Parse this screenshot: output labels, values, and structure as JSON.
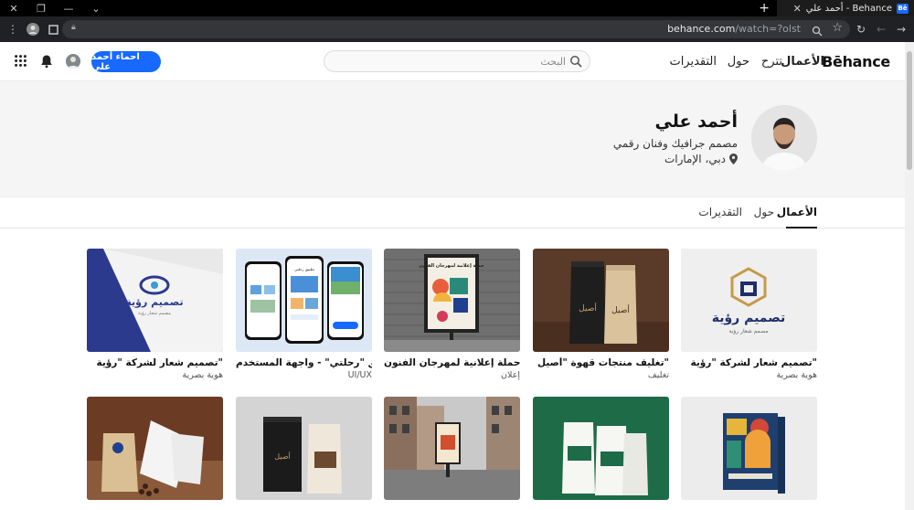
{
  "browser": {
    "tab_title": "أحمد علي - Behance",
    "tab_favicon": "Bē",
    "url_host": "behance.com",
    "url_path": "/watch=?olst"
  },
  "header": {
    "logo": "Bēhance",
    "nav": [
      "الأعمال",
      "تترح",
      "حول",
      "التقديرات"
    ],
    "search_placeholder": "البحث",
    "cta_label": "احماء أحمد علي",
    "accent": "#1769ff"
  },
  "profile": {
    "name": "أحمد علي",
    "title": "مصمم جرافيك وفنان رقمي",
    "location": "دبي، الإمارات"
  },
  "tabs": [
    "الأعمال",
    "حول",
    "التقديرات"
  ],
  "projects": [
    {
      "title": "تصميم شعار لشركة \"رؤية\"",
      "category": "هوية بصرية"
    },
    {
      "title": "تغليف منتجات قهوة \"أصيل\"",
      "category": "تغليف"
    },
    {
      "title": "حملة إعلانية لمهرجان الفنون",
      "category": "إعلان"
    },
    {
      "title": "تطبيق \"رحلتي\" - واجهة المستخدم",
      "category": "UI/UX"
    },
    {
      "title": "تصميم شعار لشركة \"رؤية\"",
      "category": "هوية بصرية"
    },
    {
      "title": "",
      "category": ""
    },
    {
      "title": "",
      "category": ""
    },
    {
      "title": "",
      "category": ""
    },
    {
      "title": "",
      "category": ""
    },
    {
      "title": "",
      "category": ""
    }
  ],
  "thumb_text": {
    "brand_ar": "تصميم رؤية",
    "brand_sub": "مصمم شعار رؤية",
    "coffee_label": "أصيل",
    "poster_title": "حملة إعلانية لمهرجان الفنون",
    "app_title": "تطبيق رحلتي"
  }
}
